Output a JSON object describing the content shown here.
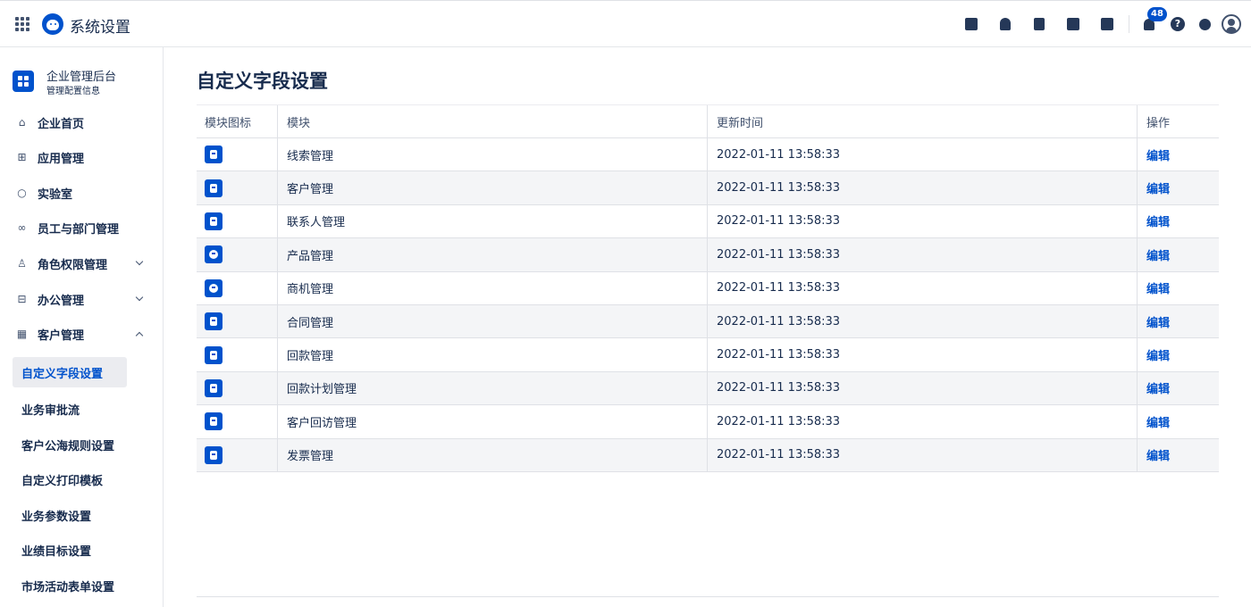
{
  "header": {
    "title": "系统设置",
    "notification_count": "48",
    "icons": [
      "apps-grid-icon",
      "logo-icon",
      "task-icon",
      "user-icon",
      "document-icon",
      "phone-icon",
      "calendar-icon",
      "bell-icon",
      "help-icon",
      "gear-icon",
      "avatar-icon"
    ]
  },
  "sidebar": {
    "org_name": "企业管理后台",
    "org_sub": "管理配置信息",
    "items": [
      {
        "label": "企业首页",
        "icon": "home-icon"
      },
      {
        "label": "应用管理",
        "icon": "apps-icon"
      },
      {
        "label": "实验室",
        "icon": "bulb-icon"
      },
      {
        "label": "员工与部门管理",
        "icon": "people-icon"
      },
      {
        "label": "角色权限管理",
        "icon": "role-icon",
        "expand": "down"
      },
      {
        "label": "办公管理",
        "icon": "briefcase-icon",
        "expand": "down"
      },
      {
        "label": "客户管理",
        "icon": "building-icon",
        "expand": "up"
      }
    ],
    "subitems": [
      {
        "label": "自定义字段设置",
        "active": true
      },
      {
        "label": "业务审批流"
      },
      {
        "label": "客户公海规则设置"
      },
      {
        "label": "自定义打印模板"
      },
      {
        "label": "业务参数设置"
      },
      {
        "label": "业绩目标设置"
      },
      {
        "label": "市场活动表单设置"
      }
    ]
  },
  "main": {
    "title": "自定义字段设置",
    "columns": [
      "模块图标",
      "模块",
      "更新时间",
      "操作"
    ],
    "rows": [
      {
        "module": "线索管理",
        "updated": "2022-01-11 13:58:33",
        "action": "编辑",
        "icon": "lead-icon"
      },
      {
        "module": "客户管理",
        "updated": "2022-01-11 13:58:33",
        "action": "编辑",
        "icon": "customer-icon"
      },
      {
        "module": "联系人管理",
        "updated": "2022-01-11 13:58:33",
        "action": "编辑",
        "icon": "contact-icon"
      },
      {
        "module": "产品管理",
        "updated": "2022-01-11 13:58:33",
        "action": "编辑",
        "icon": "product-icon"
      },
      {
        "module": "商机管理",
        "updated": "2022-01-11 13:58:33",
        "action": "编辑",
        "icon": "opportunity-icon"
      },
      {
        "module": "合同管理",
        "updated": "2022-01-11 13:58:33",
        "action": "编辑",
        "icon": "contract-icon"
      },
      {
        "module": "回款管理",
        "updated": "2022-01-11 13:58:33",
        "action": "编辑",
        "icon": "payment-icon"
      },
      {
        "module": "回款计划管理",
        "updated": "2022-01-11 13:58:33",
        "action": "编辑",
        "icon": "payment-plan-icon"
      },
      {
        "module": "客户回访管理",
        "updated": "2022-01-11 13:58:33",
        "action": "编辑",
        "icon": "visit-icon"
      },
      {
        "module": "发票管理",
        "updated": "2022-01-11 13:58:33",
        "action": "编辑",
        "icon": "invoice-icon"
      }
    ]
  },
  "colors": {
    "accent": "#0052cc",
    "text": "#172b4d",
    "row_alt": "#f4f5f7"
  }
}
